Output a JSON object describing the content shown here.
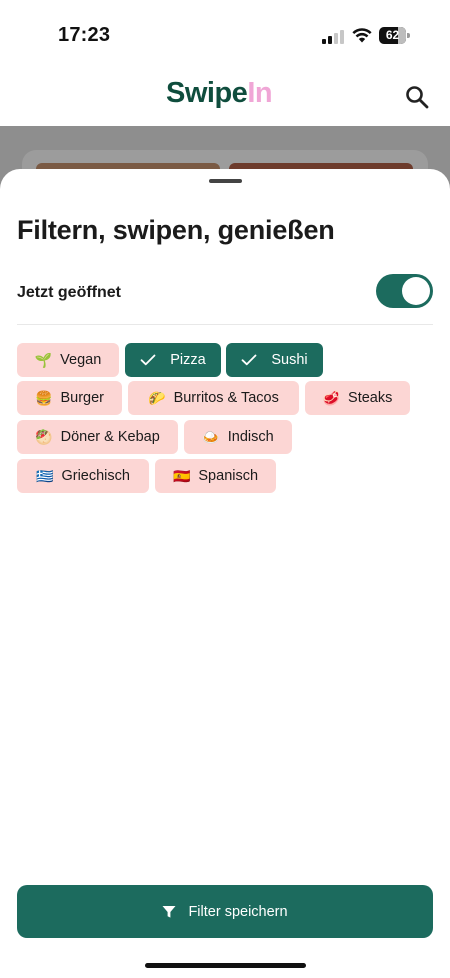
{
  "status_bar": {
    "time": "17:23",
    "battery": "62"
  },
  "header": {
    "logo_part1": "Swipe",
    "logo_part2": "In",
    "search_icon": "search-icon"
  },
  "sheet": {
    "title": "Filtern, swipen, genießen",
    "open_now": {
      "label": "Jetzt geöffnet",
      "enabled": true
    }
  },
  "chips": [
    {
      "emoji": "🌱",
      "label": "Vegan",
      "selected": false
    },
    {
      "emoji": "",
      "label": "Pizza",
      "selected": true
    },
    {
      "emoji": "",
      "label": "Sushi",
      "selected": true
    },
    {
      "emoji": "🍔",
      "label": "Burger",
      "selected": false
    },
    {
      "emoji": "🌮",
      "label": "Burritos & Tacos",
      "selected": false
    },
    {
      "emoji": "🥩",
      "label": "Steaks",
      "selected": false
    },
    {
      "emoji": "🥙",
      "label": "Döner & Kebap",
      "selected": false
    },
    {
      "emoji": "🍛",
      "label": "Indisch",
      "selected": false
    },
    {
      "emoji": "🇬🇷",
      "label": "Griechisch",
      "selected": false
    },
    {
      "emoji": "🇪🇸",
      "label": "Spanisch",
      "selected": false
    }
  ],
  "save_button": {
    "label": "Filter speichern",
    "icon": "filter-icon"
  },
  "colors": {
    "brand_green": "#1c6b5e",
    "logo_dark": "#0f4d3d",
    "logo_pink": "#f0a6d6",
    "chip_bg": "#fcd6d4"
  }
}
